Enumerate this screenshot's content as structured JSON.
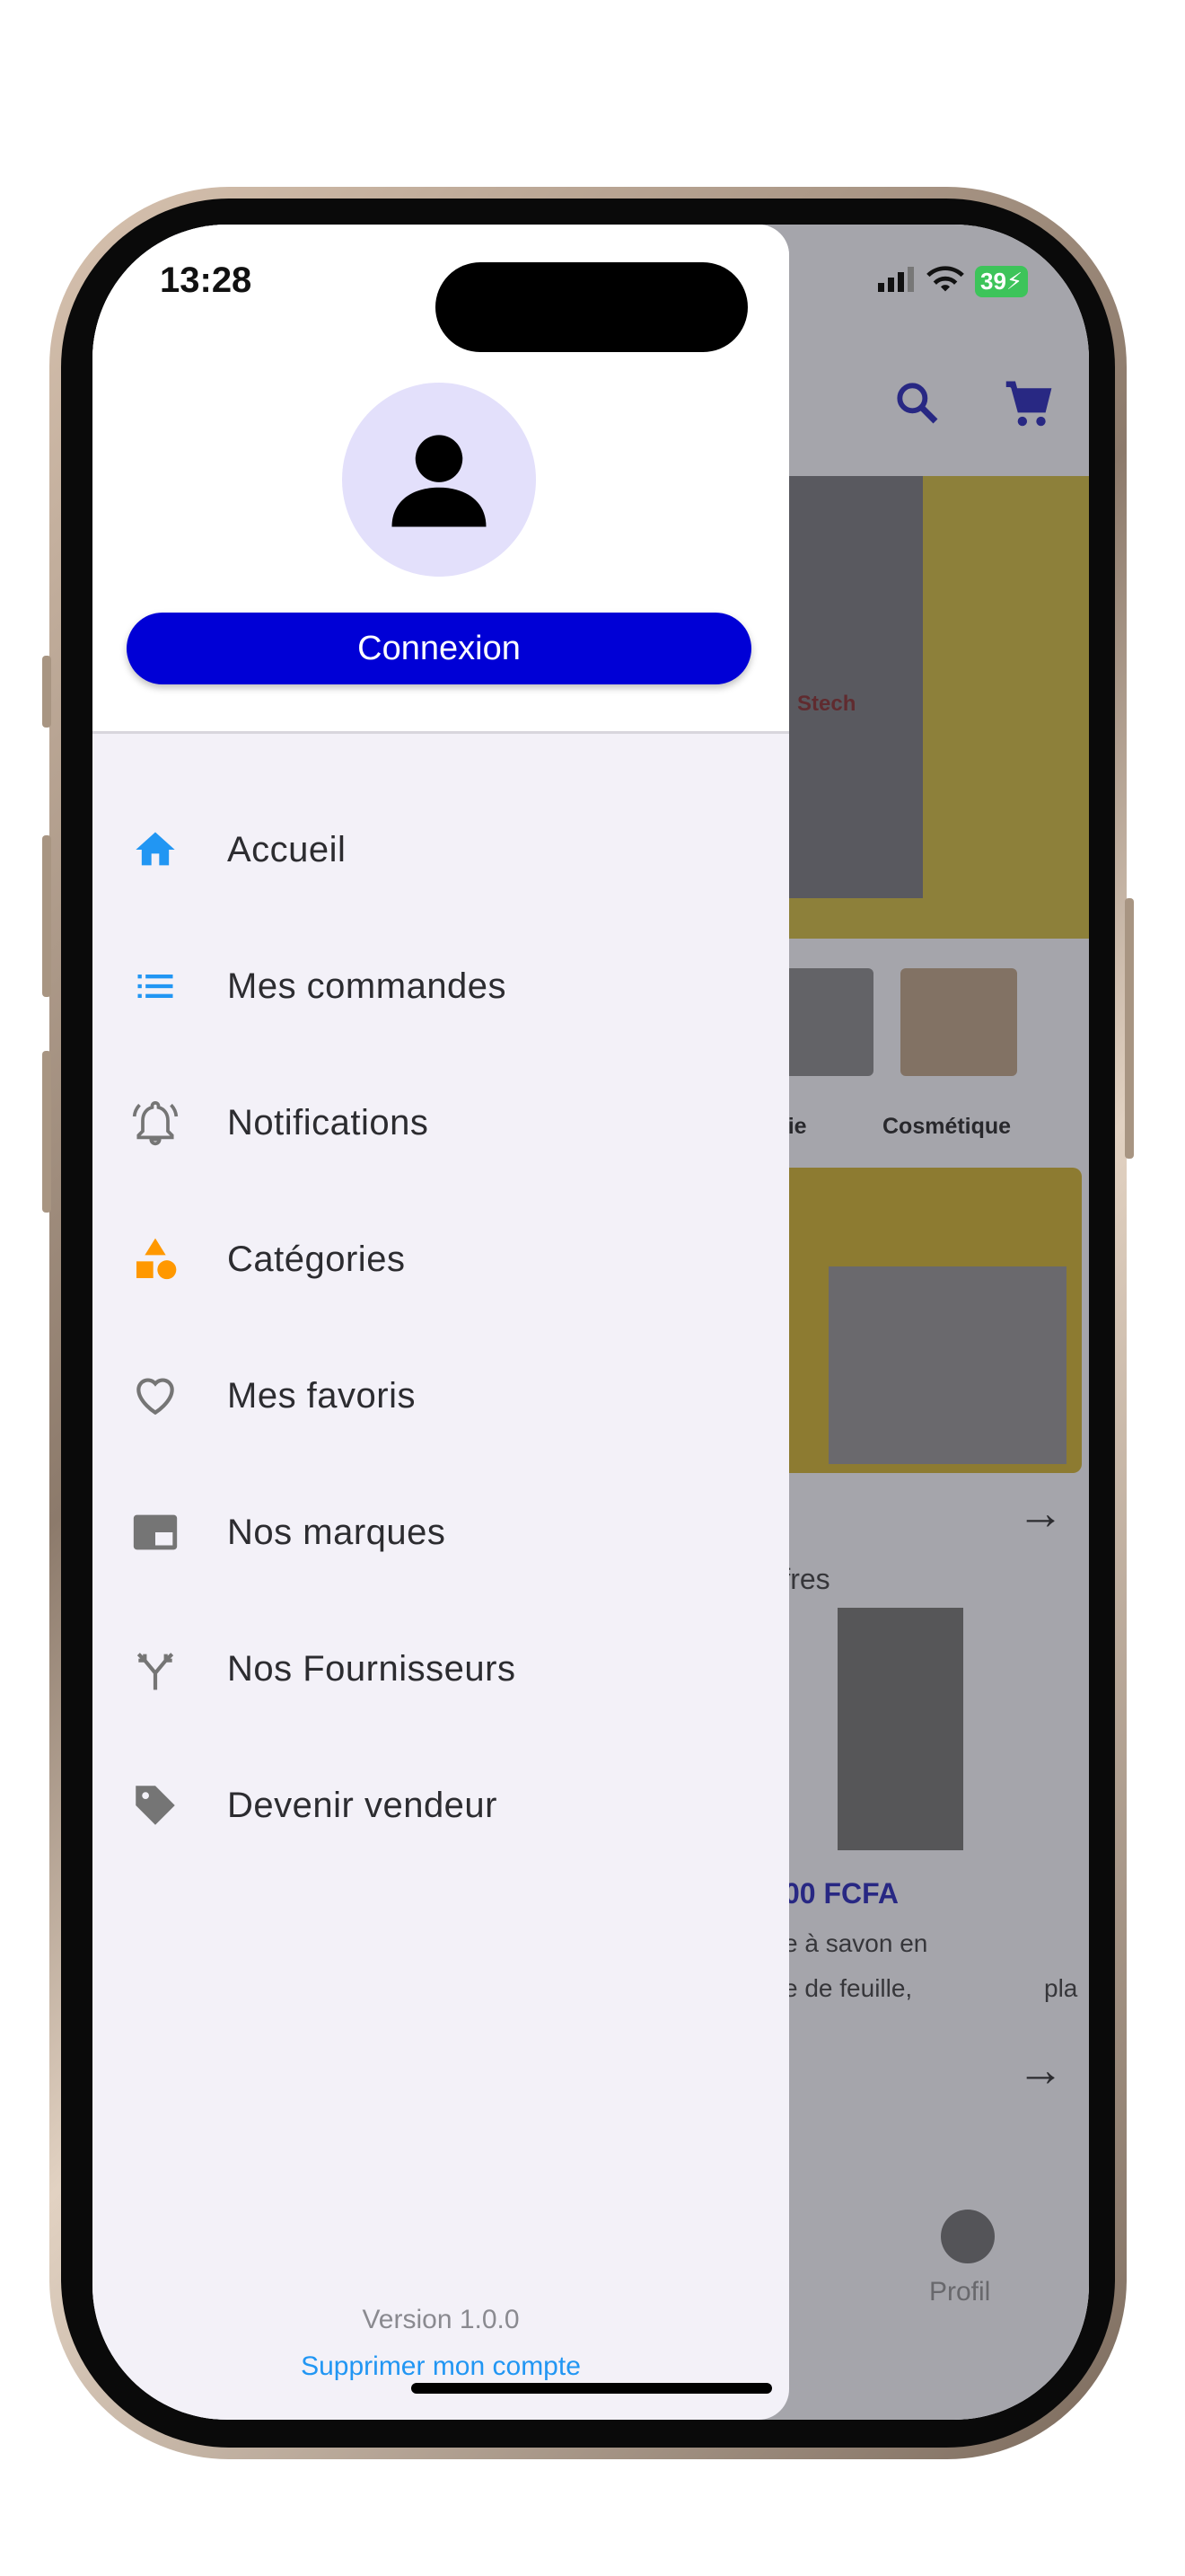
{
  "status_bar": {
    "time": "13:28",
    "battery": "39"
  },
  "drawer": {
    "login_label": "Connexion",
    "menu_items": [
      {
        "label": "Accueil",
        "icon": "home-icon"
      },
      {
        "label": "Mes commandes",
        "icon": "list-icon"
      },
      {
        "label": "Notifications",
        "icon": "bell-icon"
      },
      {
        "label": "Catégories",
        "icon": "category-shapes-icon"
      },
      {
        "label": "Mes favoris",
        "icon": "heart-icon"
      },
      {
        "label": "Nos marques",
        "icon": "brand-card-icon"
      },
      {
        "label": "Nos Fournisseurs",
        "icon": "merge-icon"
      },
      {
        "label": "Devenir vendeur",
        "icon": "tag-icon"
      }
    ],
    "version": "Version 1.0.0",
    "delete_account": "Supprimer mon compte"
  },
  "background_app": {
    "brand_text": "Stech",
    "categories": [
      "rie",
      "Cosmétique"
    ],
    "section_title": "ffres",
    "price": "00 FCFA",
    "product_line1": "e à savon en",
    "product_line2": "e de feuille,",
    "product_partial": "pla",
    "nav_profile": "Profil"
  },
  "colors": {
    "primary": "#0000d6",
    "menu_blue": "#2196f3",
    "menu_orange": "#ff9800",
    "drawer_bg": "#f3f1f8",
    "avatar_bg": "#e3e0fb"
  }
}
